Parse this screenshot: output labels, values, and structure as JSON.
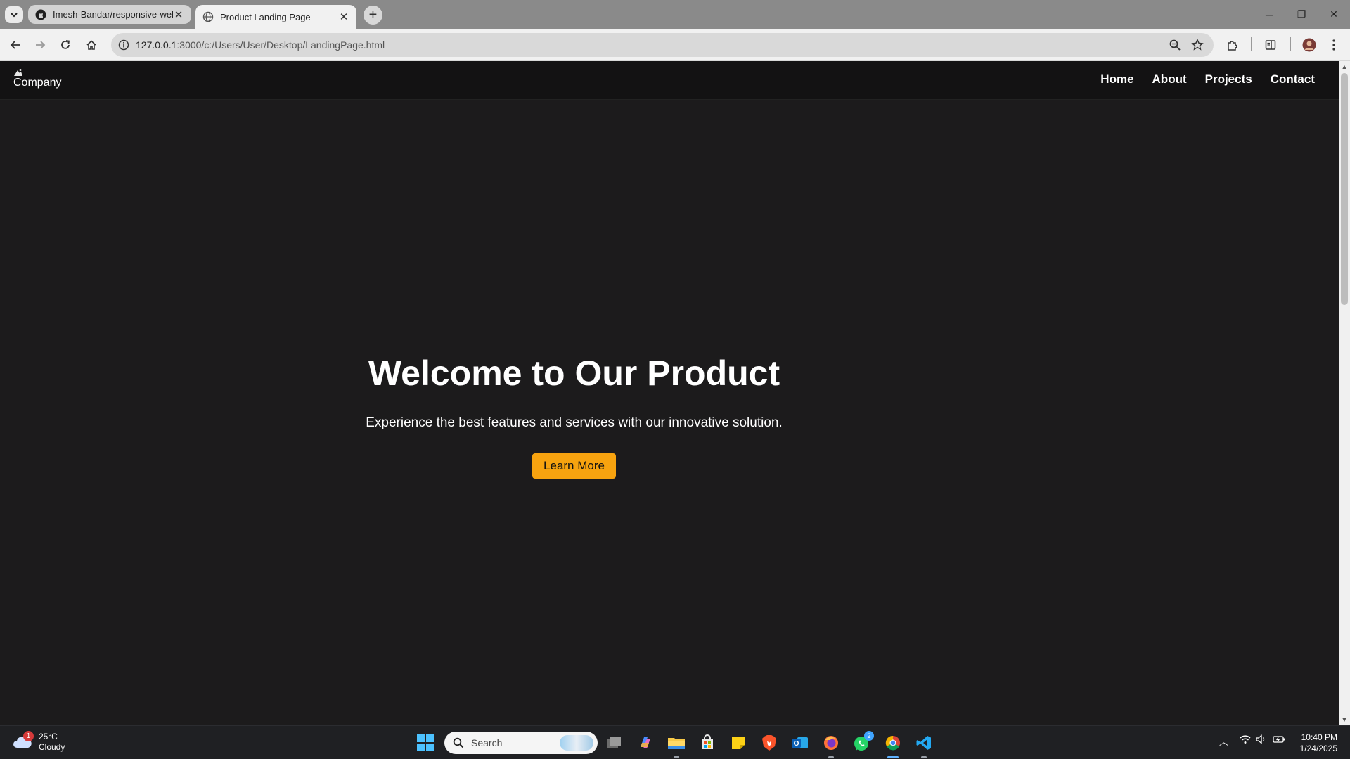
{
  "browser": {
    "tabs": [
      {
        "title": "Imesh-Bandar/responsive-web",
        "icon": "github-icon",
        "active": false
      },
      {
        "title": "Product Landing Page",
        "icon": "globe-icon",
        "active": true
      }
    ],
    "new_tab_symbol": "+",
    "address": {
      "host": "127.0.0.1",
      "rest": ":3000/c:/Users/User/Desktop/LandingPage.html"
    }
  },
  "page": {
    "logo_text": "Company",
    "nav": [
      {
        "label": "Home"
      },
      {
        "label": "About"
      },
      {
        "label": "Projects"
      },
      {
        "label": "Contact"
      }
    ],
    "hero": {
      "title": "Welcome to Our Product",
      "subtitle": "Experience the best features and services with our innovative solution.",
      "cta_label": "Learn More"
    },
    "colors": {
      "background": "#1c1b1c",
      "navbar": "#131213",
      "accent": "#f7a30f"
    }
  },
  "taskbar": {
    "weather": {
      "temp": "25°C",
      "condition": "Cloudy",
      "badge": "1"
    },
    "search_label": "Search",
    "whatsapp_badge": "2",
    "clock": {
      "time": "10:40 PM",
      "date": "1/24/2025"
    }
  }
}
